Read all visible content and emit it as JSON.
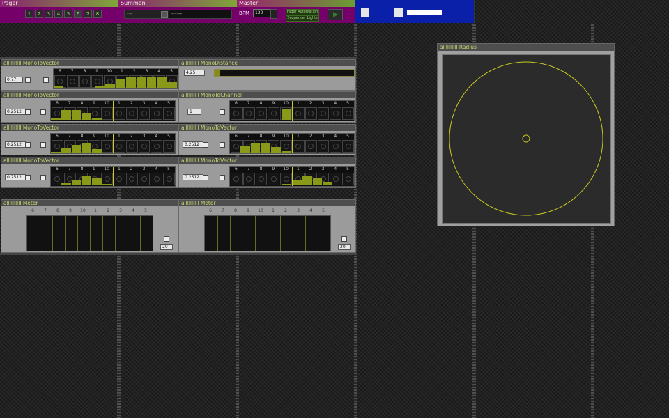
{
  "topbar": {
    "pager": {
      "title": "Pager",
      "pages": [
        "1",
        "2",
        "3",
        "4",
        "5",
        "6",
        "7",
        "8"
      ]
    },
    "summon": {
      "title": "Summon",
      "dropdown_value": "---",
      "text_value": "------"
    },
    "master": {
      "title": "Master",
      "bpm_label": "BPM -",
      "bpm_value": "120",
      "fader_automation_label": "Fader Automation",
      "sequencer_lights_label": "Sequencer Lights"
    }
  },
  "devices": [
    {
      "id": "d1",
      "title": "allllllllll MonoToVector",
      "value": "0.77",
      "levels": [
        0.1,
        0,
        0,
        0,
        0.2,
        0.4,
        0.8,
        1,
        1,
        1,
        1,
        0.5
      ]
    },
    {
      "id": "d2",
      "title": "allllllllll MonoDistance",
      "value": "4.25",
      "fill": 0.04
    },
    {
      "id": "d3",
      "title": "allllllllll MonoToVector",
      "value": "0.2512",
      "levels": [
        0.1,
        0.9,
        0.9,
        0.6,
        0.2,
        0,
        0,
        0,
        0,
        0,
        0,
        0
      ]
    },
    {
      "id": "d4",
      "title": "allllllllll MonoToChannel",
      "value": "1",
      "levels": [
        0,
        0,
        0,
        0,
        0,
        1,
        0,
        0,
        0,
        0,
        0,
        0
      ]
    },
    {
      "id": "d5",
      "title": "allllllllll MonoToVector",
      "value": "0.2512",
      "levels": [
        0.05,
        0.4,
        0.7,
        0.9,
        0.3,
        0,
        0,
        0,
        0,
        0,
        0,
        0
      ]
    },
    {
      "id": "d6",
      "title": "allllllllll MonoToVector",
      "value": "0.2512",
      "levels": [
        0,
        0.6,
        0.9,
        0.9,
        0.5,
        0.1,
        0,
        0,
        0,
        0,
        0,
        0
      ]
    },
    {
      "id": "d7",
      "title": "allllllllll MonoToVector",
      "value": "0.2512",
      "levels": [
        0,
        0.2,
        0.5,
        0.8,
        0.7,
        0.1,
        0,
        0,
        0,
        0,
        0,
        0
      ]
    },
    {
      "id": "d8",
      "title": "allllllllll MonoToVector",
      "value": "0.2512",
      "levels": [
        0,
        0,
        0,
        0,
        0,
        0.1,
        0.5,
        0.9,
        0.7,
        0.3,
        0,
        0
      ]
    },
    {
      "id": "d9",
      "title": "allllllllll Meter",
      "value": "20"
    },
    {
      "id": "d10",
      "title": "allllllllll Meter",
      "value": "20"
    }
  ],
  "grid_labels": [
    "6",
    "7",
    "8",
    "9",
    "10",
    "1",
    "2",
    "3",
    "4",
    "5"
  ],
  "meter_labels": [
    "6",
    "7",
    "8",
    "9",
    "10",
    "1",
    "2",
    "3",
    "4",
    "5"
  ],
  "radius": {
    "title": "allllllllll Radius"
  },
  "colors": {
    "topbar": "#75006a",
    "accent": "#8a9a18",
    "blue_panel": "#0a20a8"
  }
}
